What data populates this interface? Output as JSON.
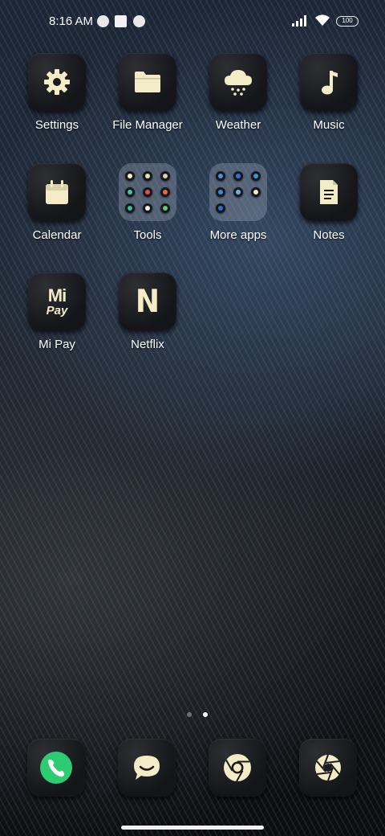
{
  "status_bar": {
    "time": "8:16 AM",
    "battery": "100",
    "notification_icons": [
      "notification-icon-1",
      "notification-icon-2",
      "notification-icon-3"
    ]
  },
  "apps": [
    {
      "label": "Settings",
      "icon": "gear-icon"
    },
    {
      "label": "File Manager",
      "icon": "folder-icon"
    },
    {
      "label": "Weather",
      "icon": "cloud-snow-icon"
    },
    {
      "label": "Music",
      "icon": "music-note-icon"
    },
    {
      "label": "Calendar",
      "icon": "calendar-icon"
    },
    {
      "label": "Tools",
      "icon": "folder-tools"
    },
    {
      "label": "More apps",
      "icon": "folder-more-apps"
    },
    {
      "label": "Notes",
      "icon": "notes-icon"
    },
    {
      "label": "Mi Pay",
      "icon": "mi-pay-icon",
      "logo_text": [
        "Mi",
        "Pay"
      ]
    },
    {
      "label": "Netflix",
      "icon": "netflix-icon",
      "logo_text": "N"
    }
  ],
  "page_indicator": {
    "pages": 2,
    "current": 2
  },
  "dock": [
    {
      "name": "phone",
      "icon": "phone-icon"
    },
    {
      "name": "messages",
      "icon": "message-icon"
    },
    {
      "name": "chrome",
      "icon": "chrome-icon"
    },
    {
      "name": "camera",
      "icon": "camera-aperture-icon"
    }
  ],
  "colors": {
    "icon_tint": "#f3ecc6",
    "phone_green": "#2ecc71"
  }
}
